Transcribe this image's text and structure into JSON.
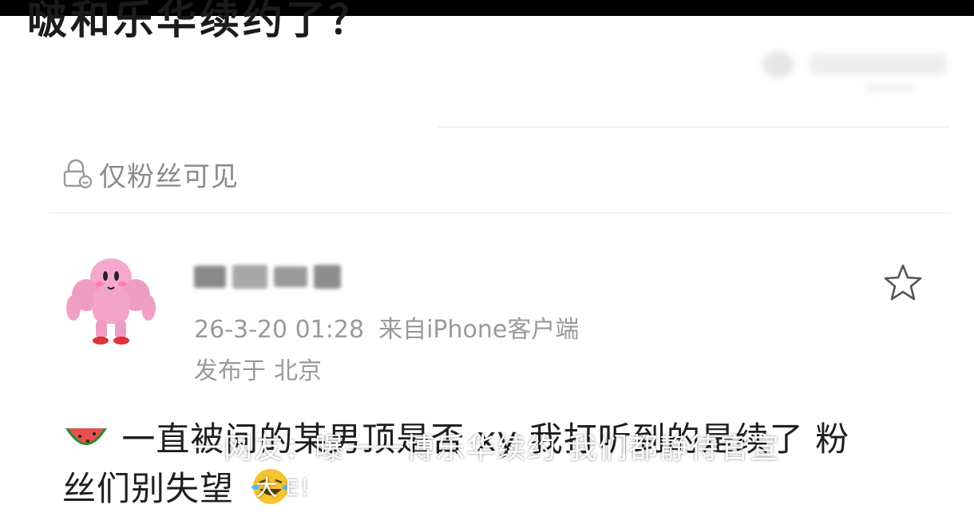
{
  "header": {
    "prev_title": "啵和乐华续约了？"
  },
  "visibility": {
    "icon": "lock-icon",
    "label": "仅粉丝可见"
  },
  "post": {
    "avatar": "kirby-muscle-avatar",
    "username_blurred": true,
    "time": "26-3-20 01:28",
    "source": "来自iPhone客户端",
    "location_prefix": "发布于",
    "location": "北京",
    "star_icon": "star-outline-icon",
    "emoji_start": "watermelon-emoji",
    "body_line1": "一直被问的某男顶是否 xy 我打听到的是续了 粉",
    "body_line2": "丝们别失望",
    "emoji_end": "laughing-emoji"
  },
  "overlay": {
    "subtitle": "一网友：曝一一博乐华续约 我们都静待官宣",
    "subtitle2": "大 E！"
  },
  "colors": {
    "text_primary": "#1f1f1f",
    "text_secondary": "#9a9a9a",
    "divider": "#f0f0f0",
    "top_bar": "#000000"
  }
}
